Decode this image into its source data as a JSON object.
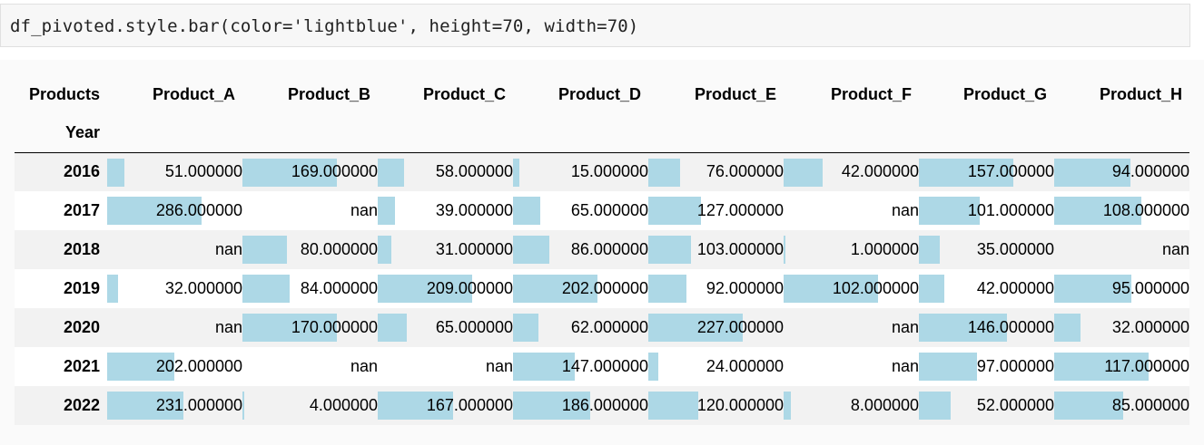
{
  "code": {
    "source": "df_pivoted.style.bar(color='lightblue', height=70, width=70)"
  },
  "table": {
    "column_index_name": "Products",
    "row_index_name": "Year",
    "columns": [
      "Product_A",
      "Product_B",
      "Product_C",
      "Product_D",
      "Product_E",
      "Product_F",
      "Product_G",
      "Product_H"
    ],
    "bar_color": "#add8e6",
    "bar_max": [
      286,
      170,
      209,
      227,
      227,
      102,
      157,
      117
    ],
    "rows": [
      {
        "year": "2016",
        "cells": [
          "51.000000",
          "169.000000",
          "58.000000",
          "15.000000",
          "76.000000",
          "42.000000",
          "157.000000",
          "94.000000"
        ]
      },
      {
        "year": "2017",
        "cells": [
          "286.000000",
          "nan",
          "39.000000",
          "65.000000",
          "127.000000",
          "nan",
          "101.000000",
          "108.000000"
        ]
      },
      {
        "year": "2018",
        "cells": [
          "nan",
          "80.000000",
          "31.000000",
          "86.000000",
          "103.000000",
          "1.000000",
          "35.000000",
          "nan"
        ]
      },
      {
        "year": "2019",
        "cells": [
          "32.000000",
          "84.000000",
          "209.000000",
          "202.000000",
          "92.000000",
          "102.000000",
          "42.000000",
          "95.000000"
        ]
      },
      {
        "year": "2020",
        "cells": [
          "nan",
          "170.000000",
          "65.000000",
          "62.000000",
          "227.000000",
          "nan",
          "146.000000",
          "32.000000"
        ]
      },
      {
        "year": "2021",
        "cells": [
          "202.000000",
          "nan",
          "nan",
          "147.000000",
          "24.000000",
          "nan",
          "97.000000",
          "117.000000"
        ]
      },
      {
        "year": "2022",
        "cells": [
          "231.000000",
          "4.000000",
          "167.000000",
          "186.000000",
          "120.000000",
          "8.000000",
          "52.000000",
          "85.000000"
        ]
      }
    ]
  }
}
